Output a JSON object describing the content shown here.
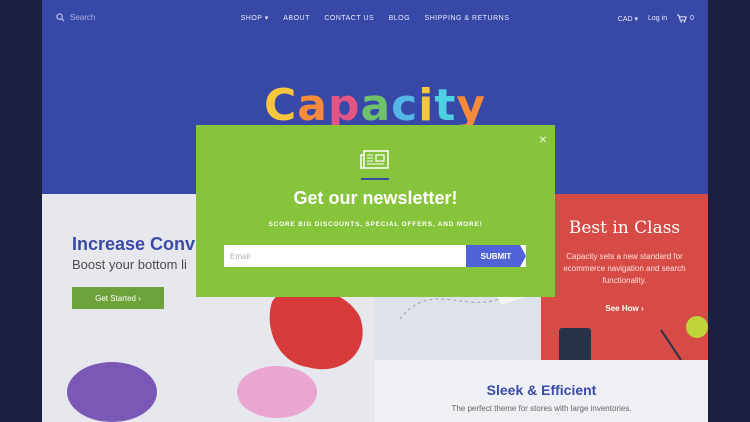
{
  "header": {
    "search_placeholder": "Search",
    "nav": [
      "SHOP ▾",
      "ABOUT",
      "CONTACT US",
      "BLOG",
      "SHIPPING & RETURNS"
    ],
    "currency": "CAD ▾",
    "login": "Log in",
    "cart_count": "0"
  },
  "logo": {
    "text": "Capacity"
  },
  "hero": {
    "title": "Increase Conv",
    "subtitle": "Boost your bottom li",
    "cta": "Get Started ›"
  },
  "best": {
    "title": "Best in Class",
    "description": "Capacity sets a new standard for ecommerce navigation and search functionality.",
    "cta": "See How ›"
  },
  "sleek": {
    "title": "Sleek & Efficient",
    "text": "The perfect theme for stores with large inventories."
  },
  "modal": {
    "close": "×",
    "title": "Get our newsletter!",
    "subtitle": "SCORE BIG DISCOUNTS, SPECIAL OFFERS, AND MORE!",
    "email_placeholder": "Email",
    "submit": "SUBMIT"
  },
  "colors": {
    "header_bg": "#3848a6",
    "modal_bg": "#86c43b",
    "submit_bg": "#4f62d6",
    "best_bg": "#d74b46",
    "cta_bg": "#6da13a"
  }
}
